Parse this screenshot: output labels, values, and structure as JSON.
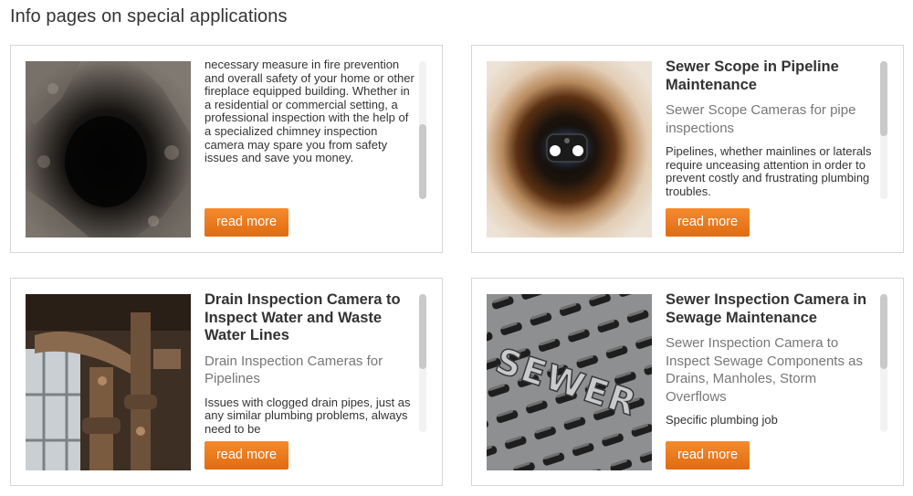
{
  "page": {
    "title": "Info pages on special applications"
  },
  "cards": [
    {
      "image": "chimney-flue-photo",
      "title": "",
      "subtitle": "",
      "body": "necessary measure in fire prevention and overall safety of your home or other fireplace equipped building. Whether in a residential or commercial setting, a professional inspection with the help of a specialized chimney inspection camera may spare you from safety issues and save you money.",
      "button": "read more"
    },
    {
      "image": "sewer-scope-pipe-photo",
      "title": "Sewer Scope in Pipeline Maintenance",
      "subtitle": "Sewer Scope Cameras for pipe inspections",
      "body": "Pipelines, whether mainlines or laterals require unceasing attention in order to prevent costly and frustrating plumbing troubles.",
      "button": "read more"
    },
    {
      "image": "rusty-drain-pipes-photo",
      "title": "Drain Inspection Camera to Inspect Water and Waste Water Lines",
      "subtitle": "Drain Inspection Cameras for Pipelines",
      "body": "Issues with clogged drain pipes, just as any similar plumbing problems, always need to be",
      "button": "read more"
    },
    {
      "image": "sewer-manhole-cover-photo",
      "title": "Sewer Inspection Camera in Sewage Maintenance",
      "subtitle": "Sewer Inspection Camera to Inspect Sewage Components as Drains, Manholes, Storm Overflows",
      "body": "Specific plumbing job",
      "button": "read more"
    }
  ],
  "colors": {
    "button": "#ee7d22",
    "border": "#d6d6d6",
    "subtitle": "#777777"
  }
}
